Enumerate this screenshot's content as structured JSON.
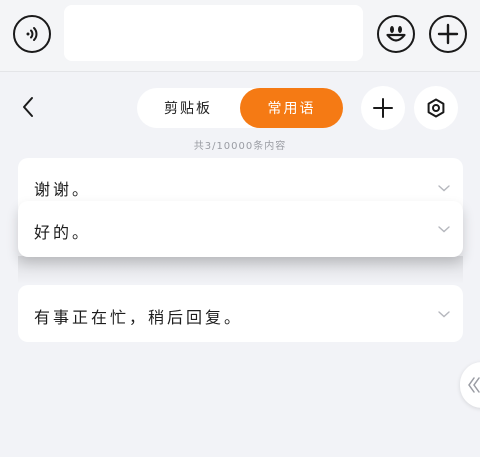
{
  "header": {
    "input_placeholder": ""
  },
  "tabs": {
    "clipboard_label": "剪贴板",
    "common_label": "常用语",
    "active": "common"
  },
  "count_text": "共3/10000条内容",
  "phrases": [
    {
      "text": "谢谢。"
    },
    {
      "text": "好的。"
    },
    {
      "text": "有事正在忙，稍后回复。"
    }
  ],
  "colors": {
    "accent": "#f57a14",
    "background": "#f2f3f7",
    "card": "#ffffff"
  },
  "icons": {
    "voice": "voice-icon",
    "emoji": "smiley-icon",
    "plus": "plus-icon",
    "back": "back-arrow-icon",
    "settings": "settings-icon",
    "chevron": "chevron-down-icon",
    "collapse": "double-chevron-left-icon"
  }
}
